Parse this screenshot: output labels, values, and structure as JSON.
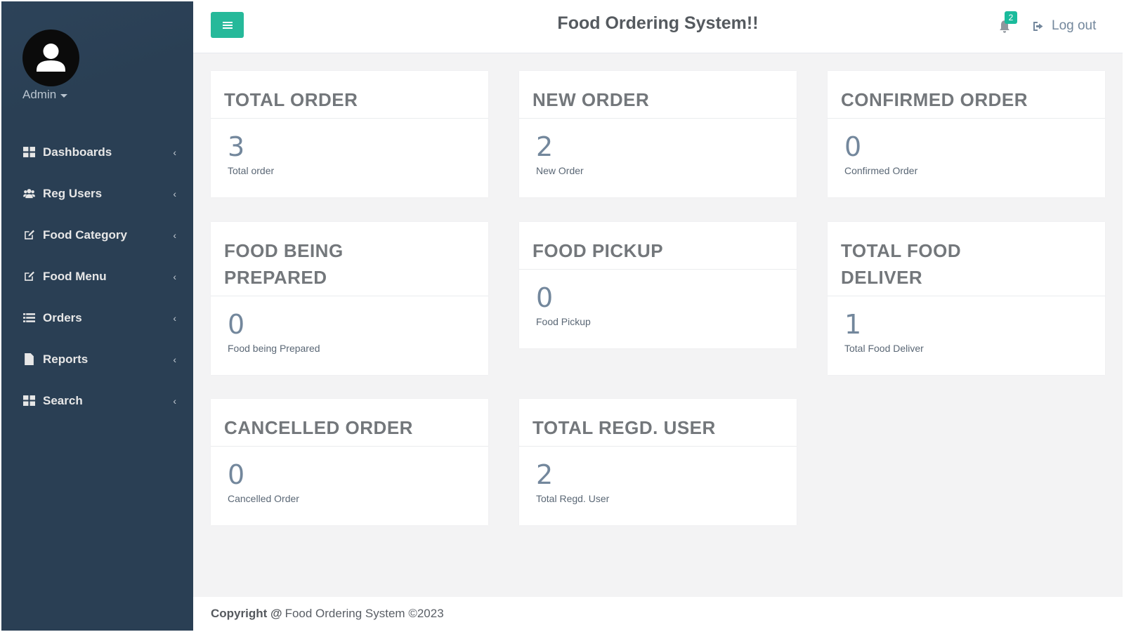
{
  "sidebar": {
    "user": {
      "name": "Admin",
      "avatar_icon": "user-silhouette-icon"
    },
    "items": [
      {
        "label": "Dashboards",
        "icon": "dashboard-grid-icon"
      },
      {
        "label": "Reg Users",
        "icon": "users-icon"
      },
      {
        "label": "Food Category",
        "icon": "edit-icon"
      },
      {
        "label": "Food Menu",
        "icon": "edit-icon"
      },
      {
        "label": "Orders",
        "icon": "list-icon"
      },
      {
        "label": "Reports",
        "icon": "file-icon"
      },
      {
        "label": "Search",
        "icon": "dashboard-grid-icon"
      }
    ],
    "chevron": "‹"
  },
  "header": {
    "title": "Food Ordering System!!",
    "menu_icon": "hamburger-icon",
    "notifications_count": "2",
    "logout_label": "Log out"
  },
  "cards": [
    {
      "title": "TOTAL ORDER",
      "value": "3",
      "sub": "Total order"
    },
    {
      "title": "NEW ORDER",
      "value": "2",
      "sub": "New Order"
    },
    {
      "title": "CONFIRMED ORDER",
      "value": "0",
      "sub": "Confirmed Order"
    },
    {
      "title": "FOOD BEING PREPARED",
      "value": "0",
      "sub": "Food being Prepared"
    },
    {
      "title": "FOOD PICKUP",
      "value": "0",
      "sub": "Food Pickup"
    },
    {
      "title": "TOTAL FOOD DELIVER",
      "value": "1",
      "sub": "Total Food Deliver"
    },
    {
      "title": "CANCELLED ORDER",
      "value": "0",
      "sub": "Cancelled Order"
    },
    {
      "title": "TOTAL REGD. USER",
      "value": "2",
      "sub": "Total Regd. User"
    }
  ],
  "footer": {
    "copyright_label": "Copyright @",
    "text": "Food Ordering System ©2023"
  },
  "colors": {
    "sidebar_bg": "#2a3f54",
    "accent": "#26b99a",
    "main_bg": "#f3f3f4"
  }
}
